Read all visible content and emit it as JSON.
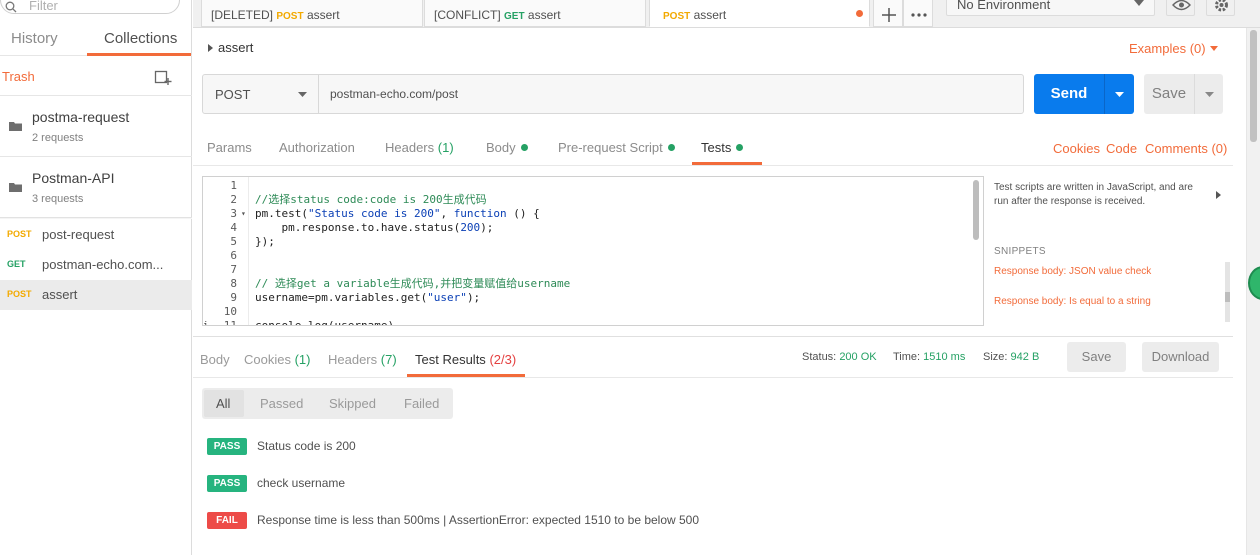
{
  "sidebar": {
    "search_placeholder": "Filter",
    "tabs": {
      "history": "History",
      "collections": "Collections"
    },
    "trash_label": "Trash",
    "folders": [
      {
        "name": "postma-request",
        "count": "2 requests"
      },
      {
        "name": "Postman-API",
        "count": "3 requests"
      }
    ],
    "requests": [
      {
        "method": "POST",
        "name": "post-request"
      },
      {
        "method": "GET",
        "name": "postman-echo.com..."
      },
      {
        "method": "POST",
        "name": "assert"
      }
    ]
  },
  "tabs": [
    {
      "tag": "[DELETED]",
      "method": "POST",
      "name": "assert"
    },
    {
      "tag": "[CONFLICT]",
      "method": "GET",
      "name": "assert"
    },
    {
      "tag": "",
      "method": "POST",
      "name": "assert"
    }
  ],
  "environment": {
    "selected": "No Environment"
  },
  "request": {
    "breadcrumb": "assert",
    "examples_label": "Examples (0)",
    "method": "POST",
    "url": "postman-echo.com/post",
    "send_label": "Send",
    "save_label": "Save"
  },
  "request_tabs": {
    "params": "Params",
    "authorization": "Authorization",
    "headers": "Headers",
    "headers_count": "(1)",
    "body": "Body",
    "prerequest": "Pre-request Script",
    "tests": "Tests",
    "cookies": "Cookies",
    "code": "Code",
    "comments": "Comments (0)"
  },
  "editor": {
    "lines": [
      {
        "n": "1",
        "text": ""
      },
      {
        "n": "2",
        "text": "//选择status code:code is 200生成代码"
      },
      {
        "n": "3",
        "text": "pm.test(\"Status code is 200\", function () {"
      },
      {
        "n": "4",
        "text": "    pm.response.to.have.status(200);"
      },
      {
        "n": "5",
        "text": "});"
      },
      {
        "n": "6",
        "text": ""
      },
      {
        "n": "7",
        "text": ""
      },
      {
        "n": "8",
        "text": "// 选择get a variable生成代码,并把变量赋值给username"
      },
      {
        "n": "9",
        "text": "username=pm.variables.get(\"user\");"
      },
      {
        "n": "10",
        "text": ""
      },
      {
        "n": "11",
        "text": "console.log(username)"
      }
    ]
  },
  "snippets": {
    "description": "Test scripts are written in JavaScript, and are run after the response is received.",
    "title": "SNIPPETS",
    "items": [
      "Response body: JSON value check",
      "Response body: Is equal to a string"
    ]
  },
  "response": {
    "tabs": {
      "body": "Body",
      "cookies": "Cookies",
      "cookies_count": "(1)",
      "headers": "Headers",
      "headers_count": "(7)",
      "test_results": "Test Results",
      "test_results_count": "(2/3)"
    },
    "status_label": "Status:",
    "status_value": "200 OK",
    "time_label": "Time:",
    "time_value": "1510 ms",
    "size_label": "Size:",
    "size_value": "942 B",
    "save_label": "Save",
    "download_label": "Download",
    "filters": [
      "All",
      "Passed",
      "Skipped",
      "Failed"
    ],
    "results": [
      {
        "status": "PASS",
        "text": "Status code is 200"
      },
      {
        "status": "PASS",
        "text": "check username"
      },
      {
        "status": "FAIL",
        "text": "Response time is less than 500ms | AssertionError: expected 1510 to be below 500"
      }
    ]
  },
  "colors": {
    "accent": "#f26b3a",
    "send_blue": "#097bed",
    "pass_green": "#26b47f",
    "fail_red": "#ed4b48"
  }
}
